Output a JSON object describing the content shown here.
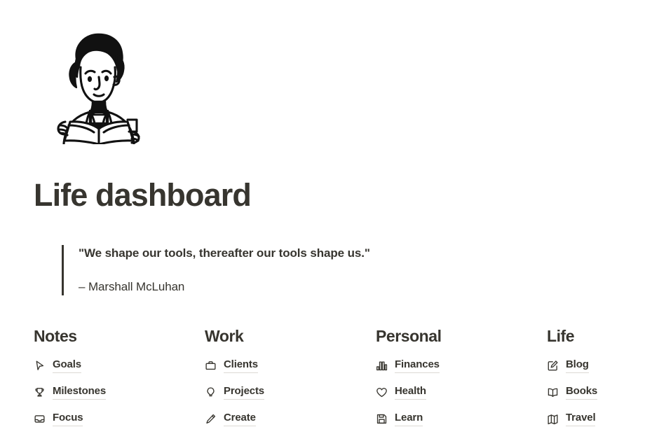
{
  "hero": {
    "illustration_name": "person-reading-book-illustration"
  },
  "header": {
    "title": "Life dashboard"
  },
  "quote": {
    "text": "\"We shape our tools, thereafter our tools shape us.\"",
    "attribution": "– Marshall McLuhan"
  },
  "columns": [
    {
      "title": "Notes",
      "items": [
        {
          "label": "Goals",
          "icon": "cursor-arrow-icon"
        },
        {
          "label": "Milestones",
          "icon": "trophy-icon"
        },
        {
          "label": "Focus",
          "icon": "inbox-tray-icon"
        }
      ]
    },
    {
      "title": "Work",
      "items": [
        {
          "label": "Clients",
          "icon": "briefcase-icon"
        },
        {
          "label": "Projects",
          "icon": "lightbulb-icon"
        },
        {
          "label": "Create",
          "icon": "pencil-icon"
        }
      ]
    },
    {
      "title": "Personal",
      "items": [
        {
          "label": "Finances",
          "icon": "bar-chart-icon"
        },
        {
          "label": "Health",
          "icon": "heart-icon"
        },
        {
          "label": "Learn",
          "icon": "floppy-disk-icon"
        }
      ]
    },
    {
      "title": "Life",
      "items": [
        {
          "label": "Blog",
          "icon": "edit-square-icon"
        },
        {
          "label": "Books",
          "icon": "open-book-icon"
        },
        {
          "label": "Travel",
          "icon": "folded-map-icon"
        }
      ]
    }
  ],
  "colors": {
    "text": "#37352f",
    "background": "#ffffff",
    "link_underline": "#dcdad5",
    "quote_border": "#37352f"
  }
}
